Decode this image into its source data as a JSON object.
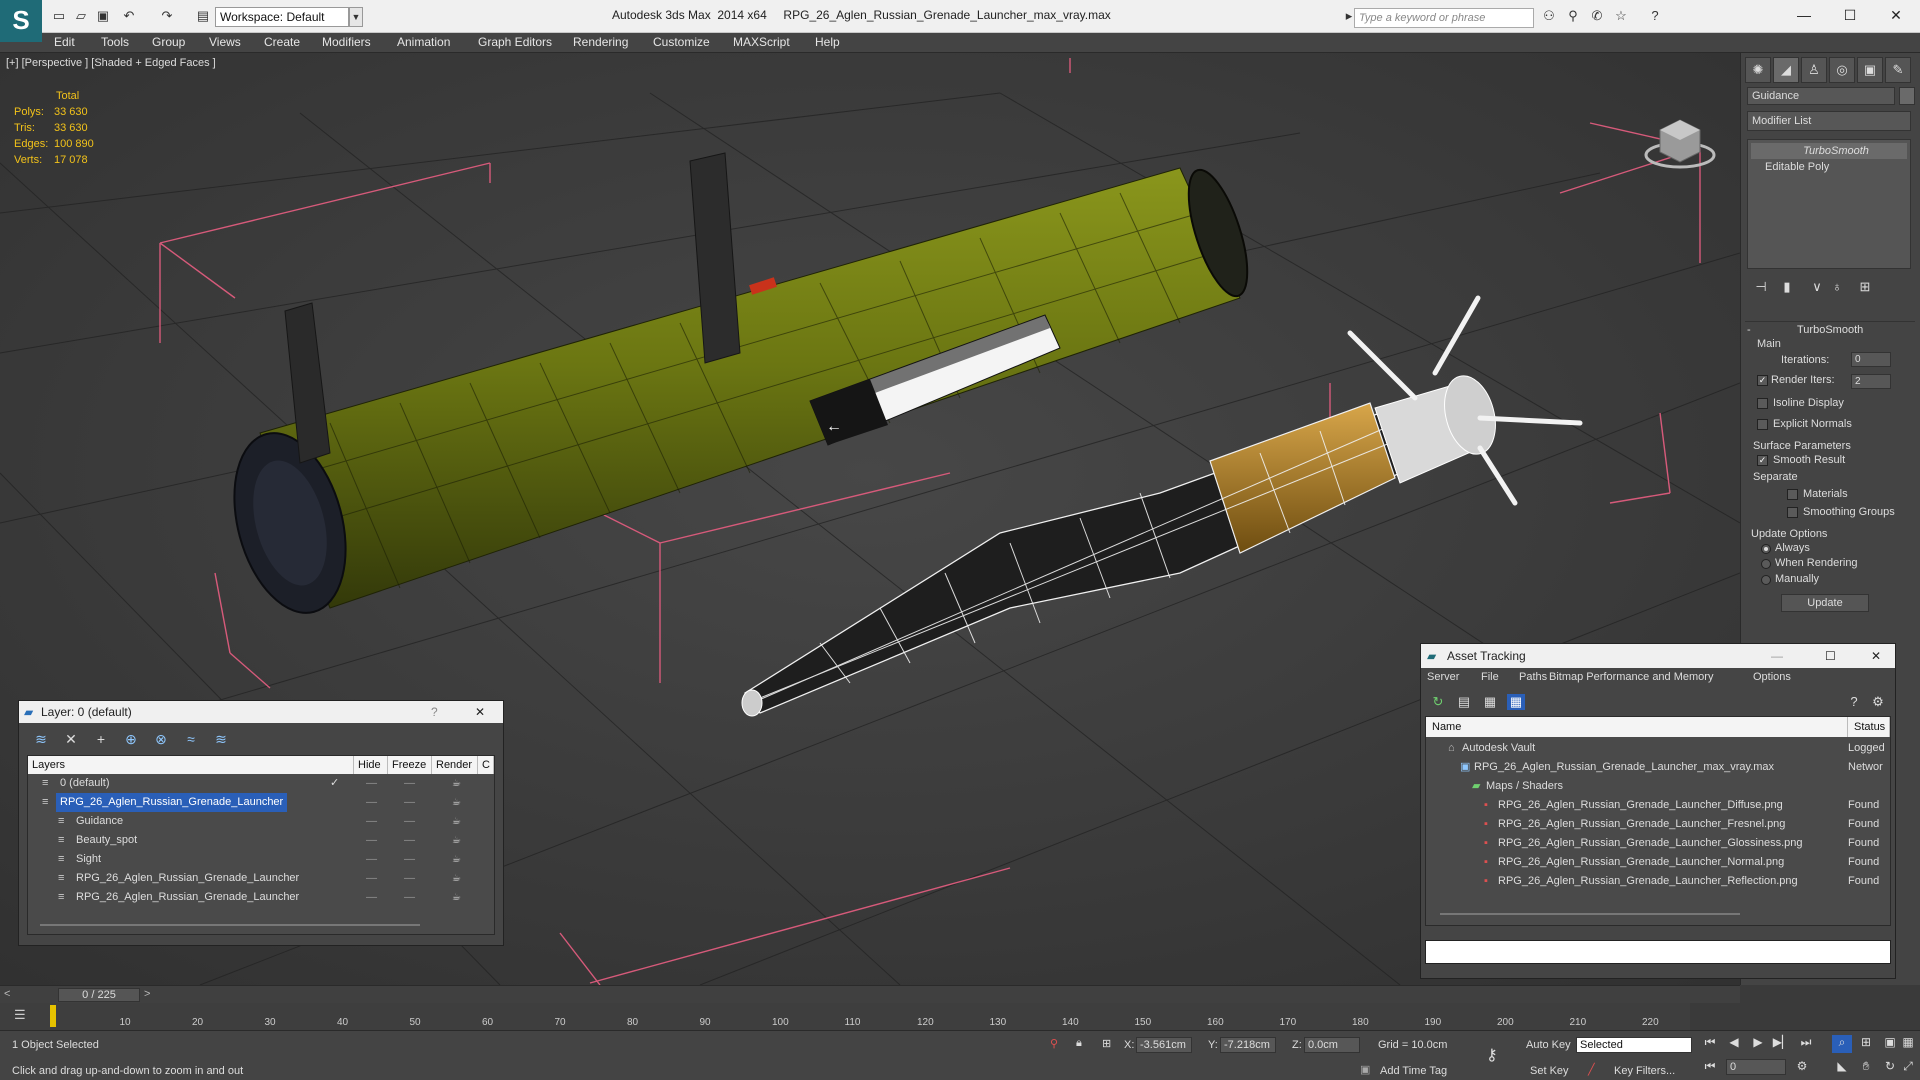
{
  "app": {
    "title": "Autodesk 3ds Max  2014 x64     RPG_26_Aglen_Russian_Grenade_Launcher_max_vray.max",
    "logo": "S",
    "workspace": "Workspace: Default",
    "search_placeholder": "Type a keyword or phrase"
  },
  "menus": [
    "Edit",
    "Tools",
    "Group",
    "Views",
    "Create",
    "Modifiers",
    "Animation",
    "Graph Editors",
    "Rendering",
    "Customize",
    "MAXScript",
    "Help"
  ],
  "viewport": {
    "label": "[+] [Perspective ] [Shaded + Edged Faces ]",
    "stats": {
      "header": "Total",
      "rows": [
        {
          "k": "Polys:",
          "v": "33 630"
        },
        {
          "k": "Tris:",
          "v": "33 630"
        },
        {
          "k": "Edges:",
          "v": "100 890"
        },
        {
          "k": "Verts:",
          "v": "17 078"
        }
      ]
    },
    "launcher_decal": "←"
  },
  "command_panel": {
    "object_name": "Guidance",
    "modifier_list": "Modifier List",
    "stack": [
      "TurboSmooth",
      "Editable Poly"
    ],
    "turbosmooth": {
      "title": "TurboSmooth",
      "main": "Main",
      "iterations_label": "Iterations:",
      "iterations": "0",
      "render_iters_label": "Render Iters:",
      "render_iters": "2",
      "isoline": "Isoline Display",
      "explicit": "Explicit Normals",
      "surface": "Surface Parameters",
      "smooth_result": "Smooth Result",
      "separate": "Separate",
      "materials": "Materials",
      "smoothing_groups": "Smoothing Groups",
      "update_options": "Update Options",
      "always": "Always",
      "when_rendering": "When Rendering",
      "manually": "Manually",
      "update": "Update"
    }
  },
  "layer_dialog": {
    "title": "Layer: 0 (default)",
    "help": "?",
    "close": "✕",
    "columns": [
      "Layers",
      "Hide",
      "Freeze",
      "Render",
      "C"
    ],
    "rows": [
      {
        "name": "0 (default)",
        "check": "✓",
        "selected": false,
        "indent": 1
      },
      {
        "name": "RPG_26_Aglen_Russian_Grenade_Launcher",
        "check": "",
        "selected": true,
        "indent": 1
      },
      {
        "name": "Guidance",
        "check": "",
        "selected": false,
        "indent": 2
      },
      {
        "name": "Beauty_spot",
        "check": "",
        "selected": false,
        "indent": 2
      },
      {
        "name": "Sight",
        "check": "",
        "selected": false,
        "indent": 2
      },
      {
        "name": "RPG_26_Aglen_Russian_Grenade_Launcher",
        "check": "",
        "selected": false,
        "indent": 2
      },
      {
        "name": "RPG_26_Aglen_Russian_Grenade_Launcher",
        "check": "",
        "selected": false,
        "indent": 2
      }
    ]
  },
  "asset_tracking": {
    "title": "Asset Tracking",
    "menu": [
      "Server",
      "File",
      "Paths",
      "Bitmap Performance and Memory",
      "Options"
    ],
    "columns": [
      "Name",
      "Status"
    ],
    "rows": [
      {
        "name": "Autodesk Vault",
        "status": "Logged",
        "indent": 1
      },
      {
        "name": "RPG_26_Aglen_Russian_Grenade_Launcher_max_vray.max",
        "status": "Networ",
        "indent": 2
      },
      {
        "name": "Maps / Shaders",
        "status": "",
        "indent": 3
      },
      {
        "name": "RPG_26_Aglen_Russian_Grenade_Launcher_Diffuse.png",
        "status": "Found",
        "indent": 4
      },
      {
        "name": "RPG_26_Aglen_Russian_Grenade_Launcher_Fresnel.png",
        "status": "Found",
        "indent": 4
      },
      {
        "name": "RPG_26_Aglen_Russian_Grenade_Launcher_Glossiness.png",
        "status": "Found",
        "indent": 4
      },
      {
        "name": "RPG_26_Aglen_Russian_Grenade_Launcher_Normal.png",
        "status": "Found",
        "indent": 4
      },
      {
        "name": "RPG_26_Aglen_Russian_Grenade_Launcher_Reflection.png",
        "status": "Found",
        "indent": 4
      }
    ]
  },
  "timeline": {
    "frame": "0 / 225",
    "ticks": [
      "10",
      "20",
      "30",
      "40",
      "50",
      "60",
      "70",
      "80",
      "90",
      "100",
      "110",
      "120",
      "130",
      "140",
      "150",
      "160",
      "170",
      "180",
      "190",
      "200",
      "210",
      "220"
    ]
  },
  "status": {
    "selected": "1 Object Selected",
    "hint": "Click and drag up-and-down to zoom in and out",
    "x_label": "X:",
    "x": "-3.561cm",
    "y_label": "Y:",
    "y": "-7.218cm",
    "z_label": "Z:",
    "z": "0.0cm",
    "grid": "Grid = 10.0cm",
    "auto_key": "Auto Key",
    "selected_set": "Selected",
    "set_key": "Set Key",
    "key_filters": "Key Filters...",
    "add_time_tag": "Add Time Tag",
    "frame_value": "0"
  }
}
